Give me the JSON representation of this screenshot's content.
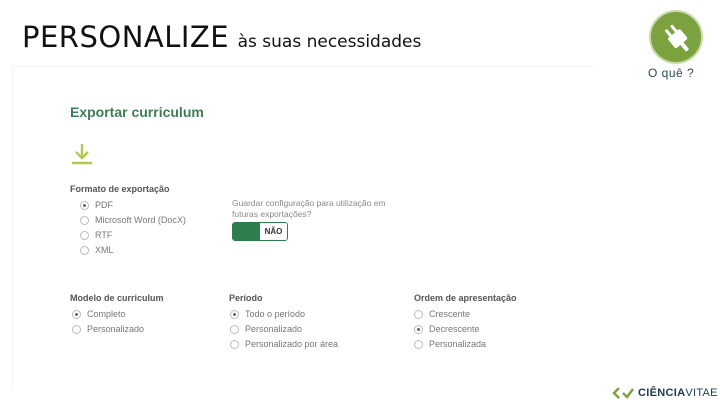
{
  "slide": {
    "title_big": "PERSONALIZE",
    "title_small": "às suas necessidades",
    "oque_label": "O quê ?",
    "logo_text_bold": "CIÊNCIA",
    "logo_text_light": "VITAE"
  },
  "card": {
    "title": "Exportar curriculum",
    "format": {
      "label": "Formato de exportação",
      "options": [
        "PDF",
        "Microsoft Word (DocX)",
        "RTF",
        "XML"
      ],
      "selected": 0
    },
    "save_config": {
      "hint": "Guardar configuração para utilização em futuras exportações?",
      "toggle_label": "NÃO"
    },
    "model": {
      "label": "Modelo de curriculum",
      "options": [
        "Completo",
        "Personalizado"
      ],
      "selected": 0
    },
    "period": {
      "label": "Período",
      "options": [
        "Todo o período",
        "Personalizado",
        "Personalizado por área"
      ],
      "selected": 0
    },
    "order": {
      "label": "Ordem de apresentação",
      "options": [
        "Crescente",
        "Decrescente",
        "Personalizada"
      ],
      "selected": 1
    }
  },
  "colors": {
    "accent_green": "#2e7d4f",
    "title_green": "#3f7b57",
    "badge_green": "#7ba23f",
    "download_icon": "#b5c94a"
  },
  "icons": [
    "plug-icon",
    "download-icon",
    "cienciavitae-logo-icon"
  ]
}
